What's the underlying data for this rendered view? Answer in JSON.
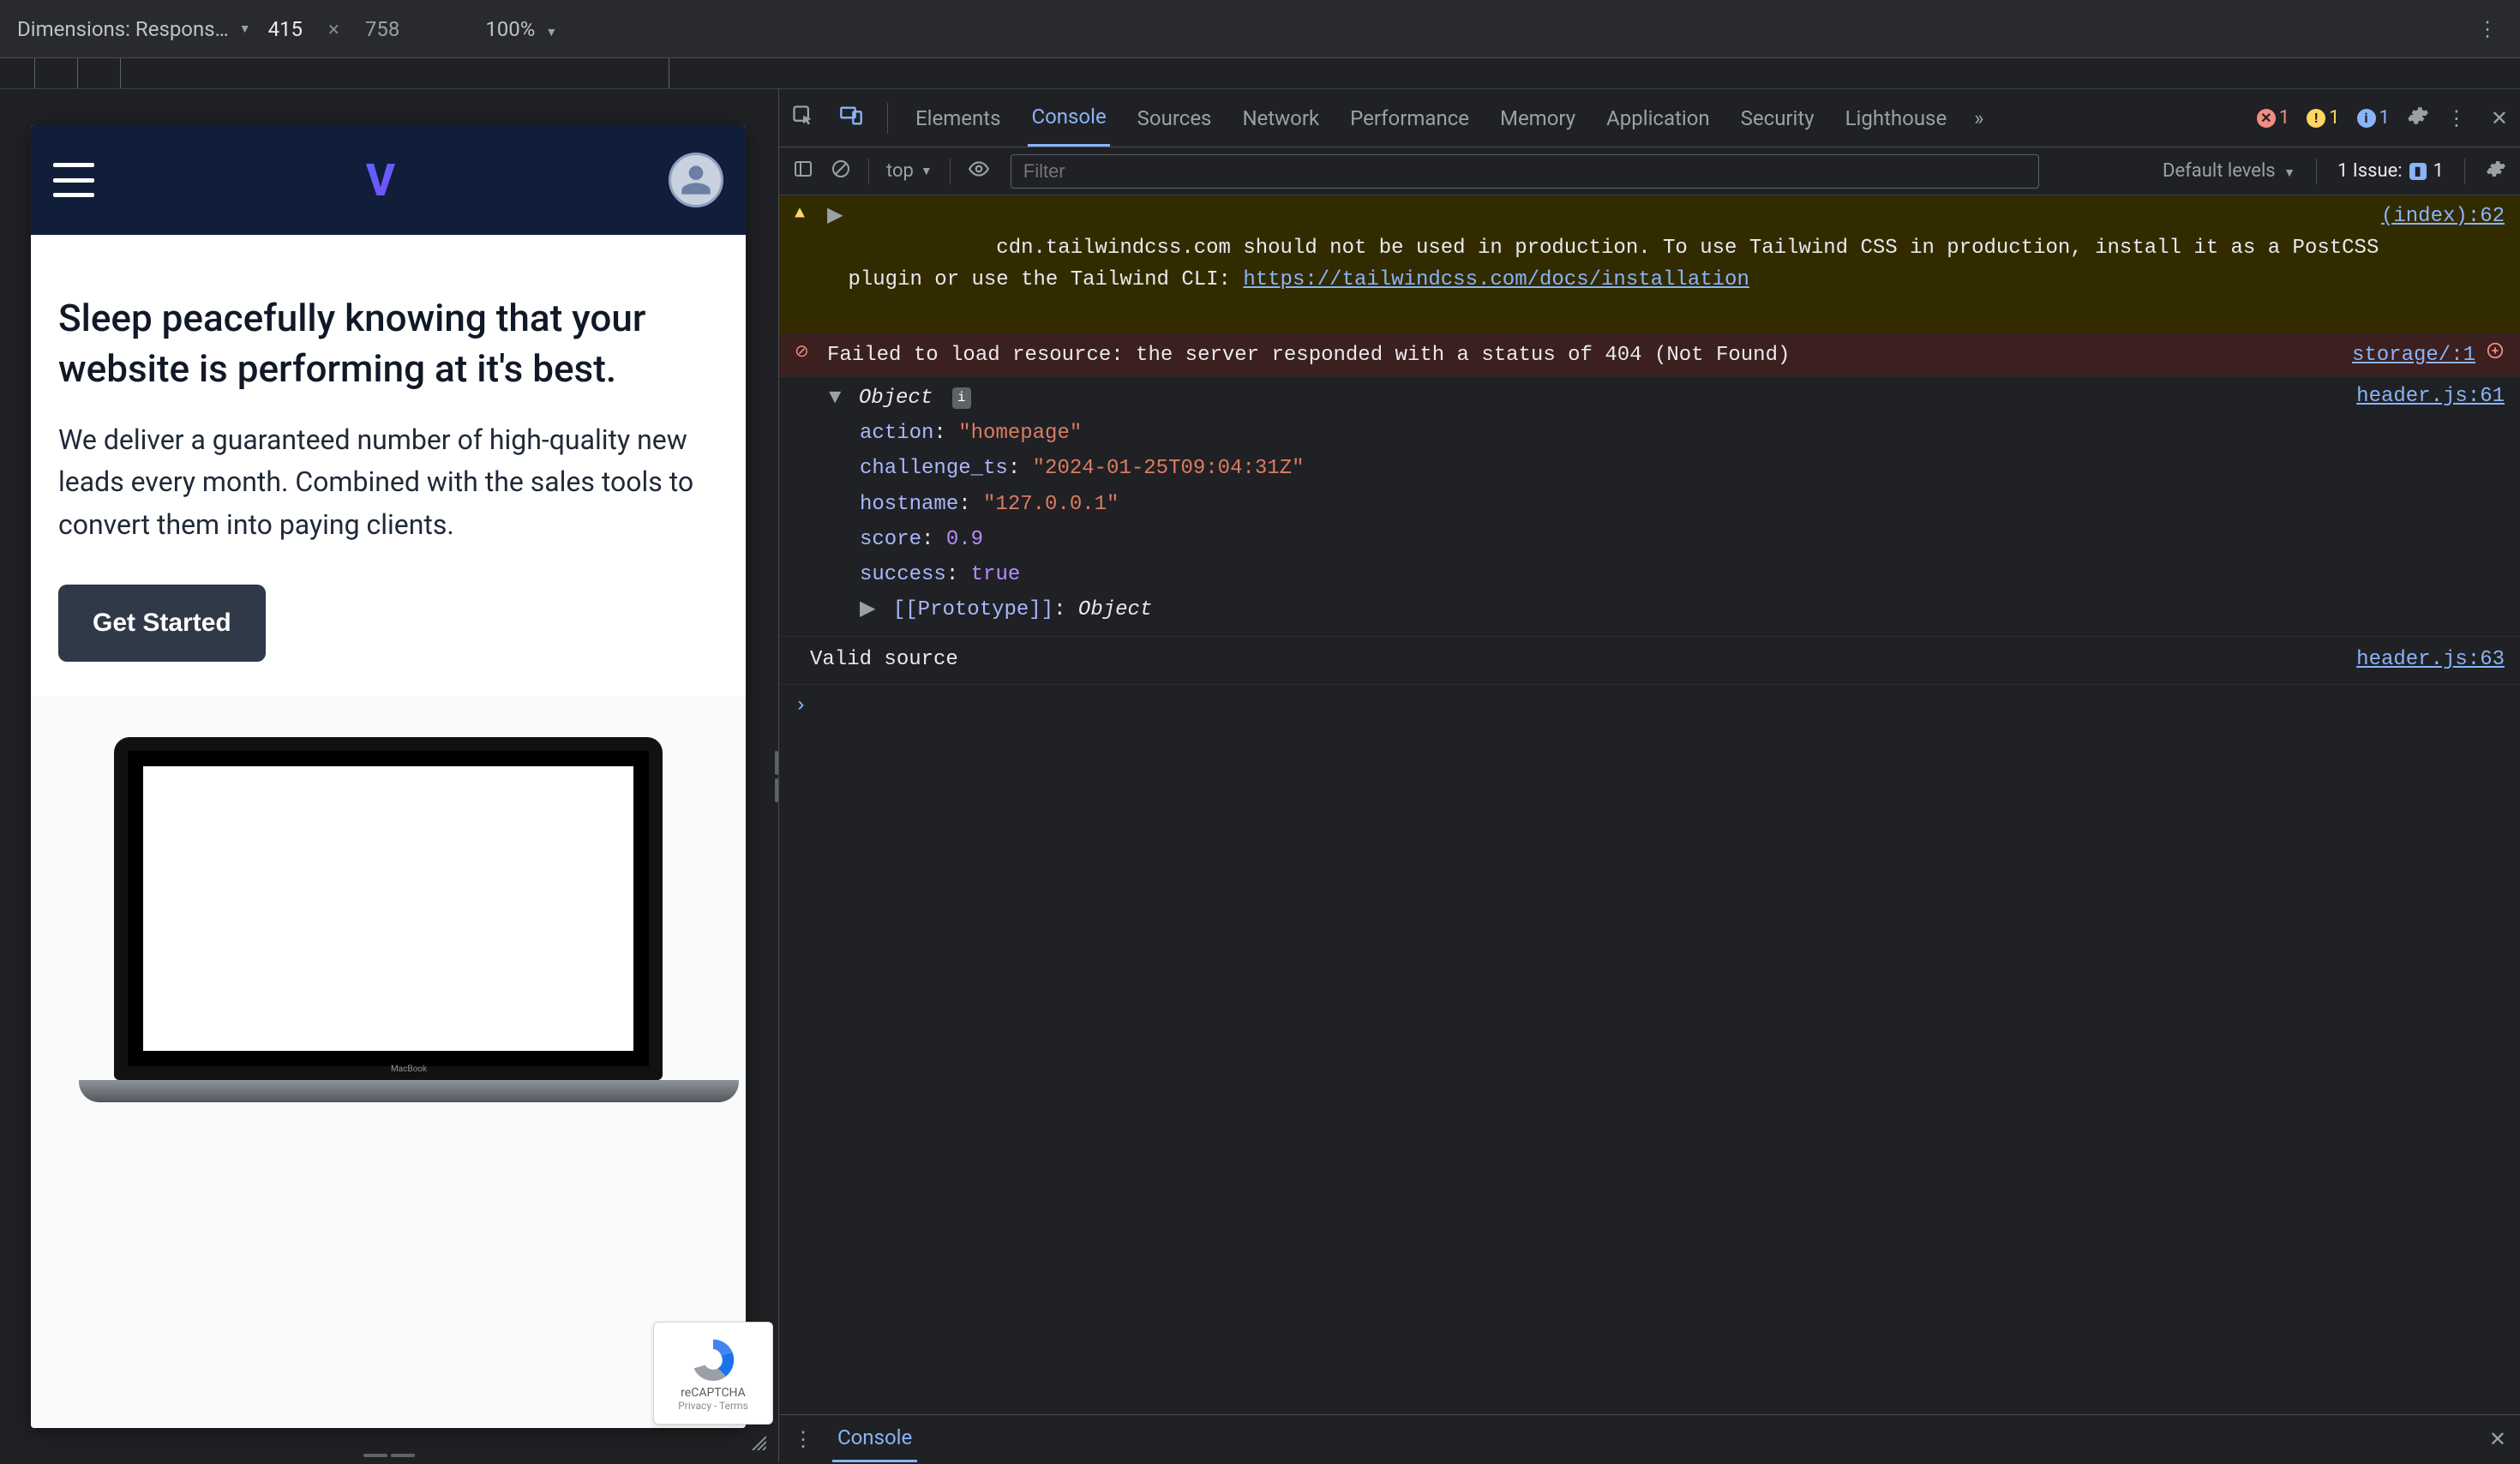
{
  "device_bar": {
    "dimensions_label": "Dimensions: Respons…",
    "width": "415",
    "sep": "×",
    "height": "758",
    "zoom": "100%",
    "kebab": "⋮"
  },
  "devtools_tabs": {
    "inspect_title": "Select an element",
    "device_title": "Toggle device toolbar",
    "items": [
      "Elements",
      "Console",
      "Sources",
      "Network",
      "Performance",
      "Memory",
      "Application",
      "Security",
      "Lighthouse"
    ],
    "more": "»",
    "err_count": "1",
    "warn_count": "1",
    "info_count": "1"
  },
  "console_bar": {
    "context": "top",
    "filter_placeholder": "Filter",
    "levels": "Default levels",
    "issue_label": "1 Issue:",
    "issue_count": "1"
  },
  "log": {
    "warn_msg_pre": "cdn.tailwindcss.com should not be used in production. To use Tailwind CSS in production, install it as a PostCSS plugin or use the Tailwind CLI: ",
    "warn_link": "https://tailwindcss.com/docs/installation",
    "warn_src": "(index):62",
    "err_msg": "Failed to load resource: the server responded with a status of 404 (Not Found)",
    "err_src": "storage/:1",
    "obj_src": "header.js:61",
    "obj_label": "Object",
    "info_badge": "i",
    "obj": {
      "action_key": "action",
      "action_val": "\"homepage\"",
      "challenge_key": "challenge_ts",
      "challenge_val": "\"2024-01-25T09:04:31Z\"",
      "hostname_key": "hostname",
      "hostname_val": "\"127.0.0.1\"",
      "score_key": "score",
      "score_val": "0.9",
      "success_key": "success",
      "success_val": "true",
      "proto_key": "[[Prototype]]",
      "proto_val": "Object"
    },
    "valid_msg": "Valid source",
    "valid_src": "header.js:63",
    "prompt": "›"
  },
  "drawer": {
    "kebab": "⋮",
    "console_tab": "Console",
    "close": "✕"
  },
  "page": {
    "logo": "V",
    "hero_title": "Sleep peacefully knowing that your website is performing at it's best.",
    "hero_sub": "We deliver a guaranteed number of high-quality new leads every month. Combined with the sales tools to convert them into paying clients.",
    "cta": "Get Started",
    "laptop_label": "MacBook",
    "recaptcha_label": "reCAPTCHA",
    "recaptcha_pt": "Privacy - Terms"
  }
}
